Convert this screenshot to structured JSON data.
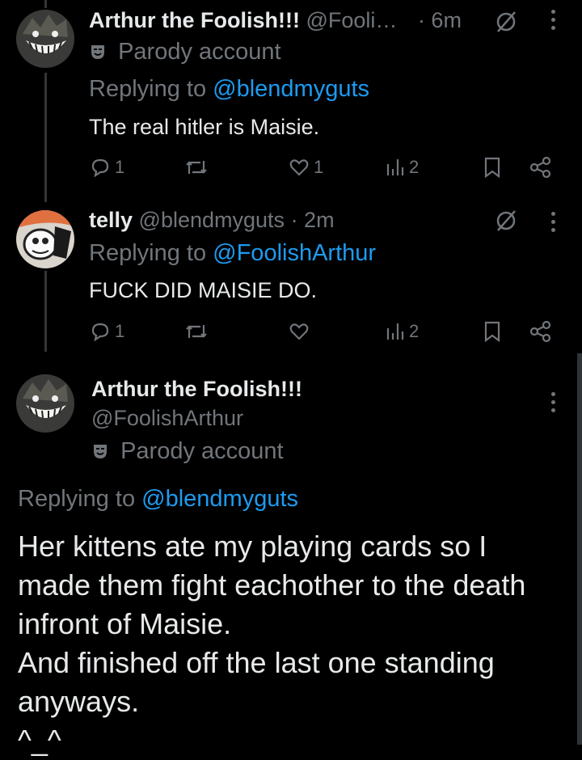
{
  "tweets": [
    {
      "display_name": "Arthur the Foolish!!!",
      "handle": "@Fooli…",
      "time": "· 6m",
      "badge": "Parody account",
      "replying_prefix": "Replying to",
      "replying_to": "@blendmyguts",
      "text": "The real hitler is Maisie.",
      "replies": "1",
      "likes": "1",
      "views": "2"
    },
    {
      "display_name": "telly",
      "handle": "@blendmyguts",
      "time": "· 2m",
      "replying_prefix": "Replying to",
      "replying_to": "@FoolishArthur",
      "text": "FUCK DID MAISIE DO.",
      "replies": "1",
      "likes": "",
      "views": "2"
    }
  ],
  "focused": {
    "display_name": "Arthur the Foolish!!!",
    "handle": "@FoolishArthur",
    "badge": "Parody account",
    "replying_prefix": "Replying to",
    "replying_to": "@blendmyguts",
    "lines": [
      "Her kittens ate my playing cards so I",
      "made them fight eachother to the death",
      "infront of Maisie.",
      "And finished off the last one standing",
      "anyways.",
      "^_^"
    ]
  },
  "colors": {
    "background": "#000000",
    "text": "#e7e9ea",
    "secondary": "#71767b",
    "link": "#1d9bf0"
  },
  "icons": [
    "reply-icon",
    "retweet-icon",
    "like-icon",
    "views-icon",
    "bookmark-icon",
    "share-icon",
    "mute-icon",
    "more-icon",
    "parody-mask-icon"
  ]
}
